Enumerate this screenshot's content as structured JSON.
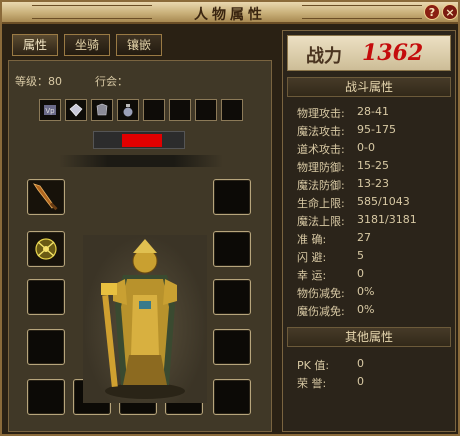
{
  "window": {
    "title": "人物属性"
  },
  "tabs": [
    {
      "label": "属性"
    },
    {
      "label": "坐骑"
    },
    {
      "label": "镶嵌"
    }
  ],
  "character": {
    "level_label": "等级：",
    "level_value": "80",
    "guild_label": "行会："
  },
  "buffs": [
    {
      "icon": "rune-icon"
    },
    {
      "icon": "gem-icon"
    },
    {
      "icon": "armor-icon"
    },
    {
      "icon": "potion-icon"
    },
    {
      "icon": "empty"
    },
    {
      "icon": "empty"
    },
    {
      "icon": "empty"
    },
    {
      "icon": "empty"
    }
  ],
  "power": {
    "label": "战力",
    "value": "1362"
  },
  "combat_section": {
    "title": "战斗属性",
    "stats": [
      {
        "label": "物理攻击:",
        "value": "28-41"
      },
      {
        "label": "魔法攻击:",
        "value": "95-175"
      },
      {
        "label": "道术攻击:",
        "value": "0-0"
      },
      {
        "label": "物理防御:",
        "value": "15-25"
      },
      {
        "label": "魔法防御:",
        "value": "13-23"
      },
      {
        "label": "生命上限:",
        "value": "585/1043"
      },
      {
        "label": "魔法上限:",
        "value": "3181/3181"
      },
      {
        "label": "准   确:",
        "value": "27"
      },
      {
        "label": "闪   避:",
        "value": "5"
      },
      {
        "label": "幸   运:",
        "value": "0"
      },
      {
        "label": "物伤减免:",
        "value": "0%"
      },
      {
        "label": "魔伤减免:",
        "value": "0%"
      }
    ]
  },
  "other_section": {
    "title": "其他属性",
    "stats": [
      {
        "label": "PK    值:",
        "value": "0"
      },
      {
        "label": "荣    誉:",
        "value": "0"
      }
    ]
  },
  "colors": {
    "power_value": "#c40c0c",
    "hp_bar": "#e20000",
    "frame_gold": "#8a6a3a"
  }
}
